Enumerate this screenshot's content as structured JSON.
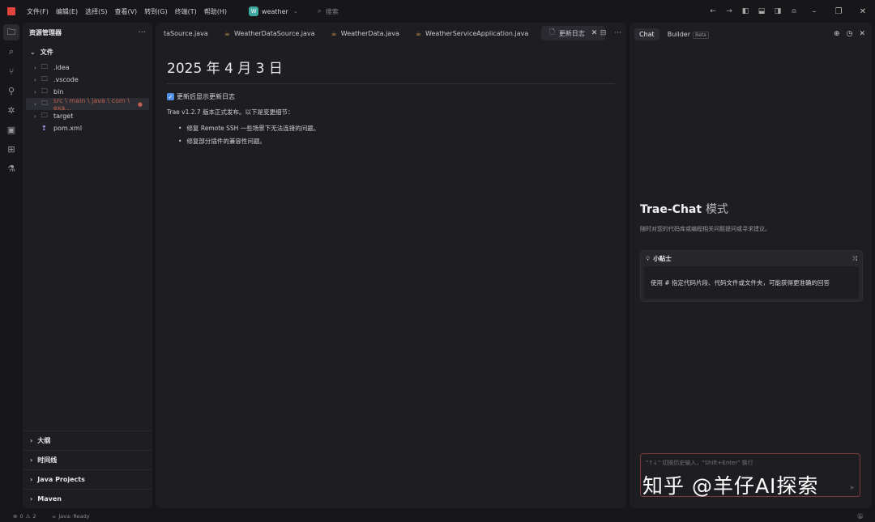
{
  "menu": [
    "文件(F)",
    "编辑(E)",
    "选择(S)",
    "查看(V)",
    "转到(G)",
    "终端(T)",
    "帮助(H)"
  ],
  "project": {
    "badge": "W",
    "name": "weather"
  },
  "search": {
    "placeholder": "搜索"
  },
  "sidebar": {
    "title": "资源管理器",
    "files_section": "文件",
    "tree": [
      {
        "label": ".idea",
        "type": "folder"
      },
      {
        "label": ".vscode",
        "type": "folder"
      },
      {
        "label": "bin",
        "type": "folder"
      },
      {
        "label": "src \\ main \\ java \\ com \\ exa...",
        "type": "folder",
        "selected": true,
        "error": "●"
      },
      {
        "label": "target",
        "type": "folder"
      },
      {
        "label": "pom.xml",
        "type": "file"
      }
    ],
    "bottom_sections": [
      "大纲",
      "时间线",
      "Java Projects",
      "Maven"
    ]
  },
  "editor": {
    "tabs": [
      {
        "label": "taSource.java",
        "icon": ""
      },
      {
        "label": "WeatherDataSource.java",
        "icon": "☕"
      },
      {
        "label": "WeatherData.java",
        "icon": "☕"
      },
      {
        "label": "WeatherServiceApplication.java",
        "icon": "☕"
      }
    ],
    "active_tab": "更新日志",
    "doc": {
      "title": "2025 年 4 月 3 日",
      "checkbox_label": "更新后显示更新日志",
      "intro": "Trae v1.2.7 版本正式发布。以下是变更细节：",
      "bullets": [
        "修复 Remote SSH 一些场景下无法连接的问题。",
        "修复部分插件的兼容性问题。"
      ]
    }
  },
  "chat": {
    "tabs": {
      "chat": "Chat",
      "builder": "Builder",
      "beta": "Beta"
    },
    "welcome_title": "Trae-Chat",
    "welcome_mode": "模式",
    "welcome_sub": "随时对您的代码库或编程相关问题提问或寻求建议。",
    "tip_title": "小贴士",
    "tip_body": "使用 # 指定代码片段、代码文件或文件夹，可能获得更准确的回答",
    "input_placeholder": "\"↑↓\" 切换历史输入，\"Shift+Enter\" 换行"
  },
  "status": {
    "errors": "0",
    "warnings": "2",
    "java_status": "Java: Ready"
  },
  "watermark": "知乎 @羊仔AI探索"
}
